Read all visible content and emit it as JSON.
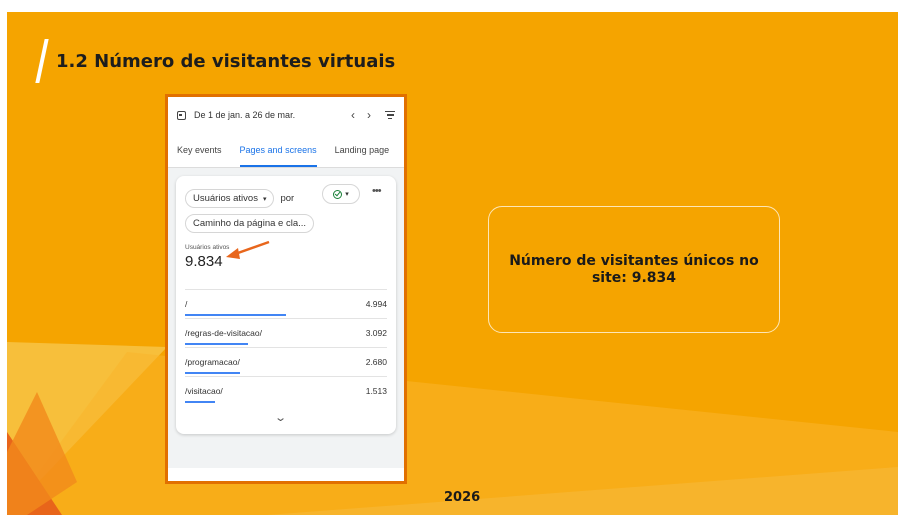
{
  "slide": {
    "title": "1.2 Número de visitantes virtuais",
    "year": "2026",
    "info_text": "Número de visitantes únicos no site: 9.834"
  },
  "analytics": {
    "date_range": "De 1 de jan. a 26 de mar.",
    "tabs": [
      {
        "label": "Key events",
        "active": false
      },
      {
        "label": "Pages and screens",
        "active": true
      },
      {
        "label": "Landing page",
        "active": false
      }
    ],
    "metric_selector": "Usuários ativos",
    "por_label": "por",
    "dimension_selector": "Caminho da página e cla...",
    "metric_label": "Usuários ativos",
    "metric_value": "9.834",
    "rows": [
      {
        "path": "/",
        "value": "4.994",
        "share": 0.5
      },
      {
        "path": "/regras-de-visitacao/",
        "value": "3.092",
        "share": 0.31
      },
      {
        "path": "/programacao/",
        "value": "2.680",
        "share": 0.27
      },
      {
        "path": "/visitacao/",
        "value": "1.513",
        "share": 0.15
      }
    ]
  },
  "colors": {
    "background": "#f5a400",
    "accent_border": "#e17000",
    "arrow": "#e8661c",
    "link_blue": "#1a73e8"
  },
  "icons": [
    "calendar-icon",
    "chevron-left-icon",
    "chevron-right-icon",
    "filter-icon",
    "check-circle-icon",
    "more-icon",
    "chevron-down-icon"
  ]
}
